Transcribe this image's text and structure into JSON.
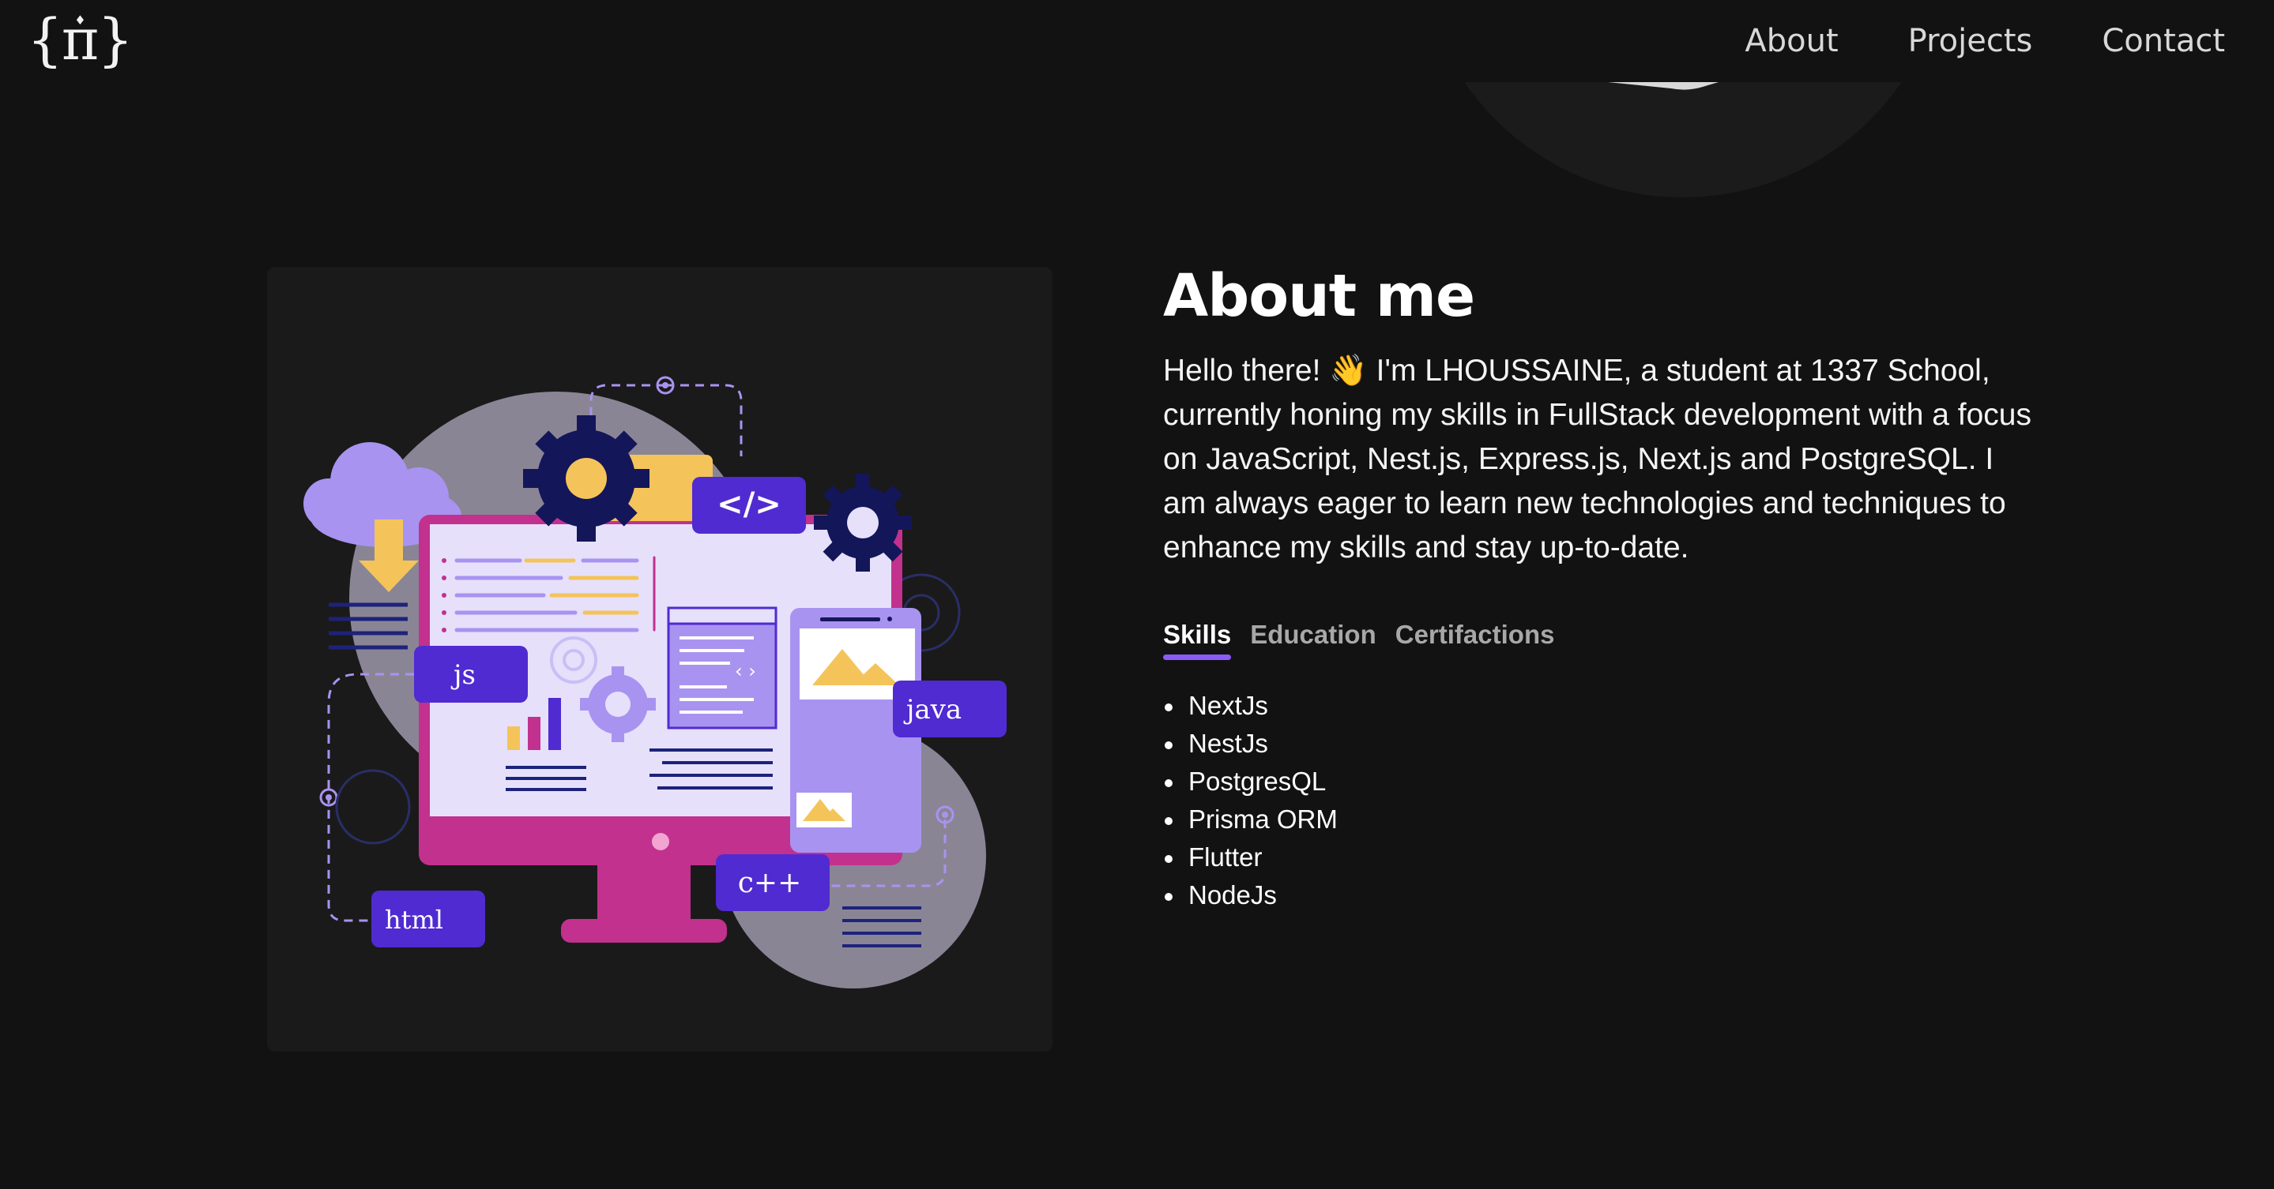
{
  "nav": {
    "logo": "{π}",
    "links": [
      "About",
      "Projects",
      "Contact"
    ]
  },
  "about": {
    "title": "About me",
    "intro": "Hello there! 👋 I'm LHOUSSAINE, a student at 1337 School, currently honing my skills in FullStack development with a focus on JavaScript, Nest.js, Express.js, Next.js and PostgreSQL. I am always eager to learn new technologies and techniques to enhance my skills and stay up-to-date.",
    "tabs": [
      "Skills",
      "Education",
      "Certifactions"
    ],
    "active_tab": "Skills",
    "skills": [
      "NextJs",
      "NestJs",
      "PostgresQL",
      "Prisma ORM",
      "Flutter",
      "NodeJs"
    ]
  },
  "illustration": {
    "labels": {
      "js": "js",
      "java": "java",
      "cpp": "c++",
      "html": "html",
      "code": "</>"
    }
  },
  "colors": {
    "background": "#121212",
    "card": "#1a1a1a",
    "accent": "#8b5cf6",
    "label_bg": "#4f2bd1",
    "monitor_frame": "#c2318e",
    "screen": "#e6e0fb",
    "gear": "#14165a",
    "lavender": "#a993f0",
    "yellow": "#f4c45a"
  }
}
